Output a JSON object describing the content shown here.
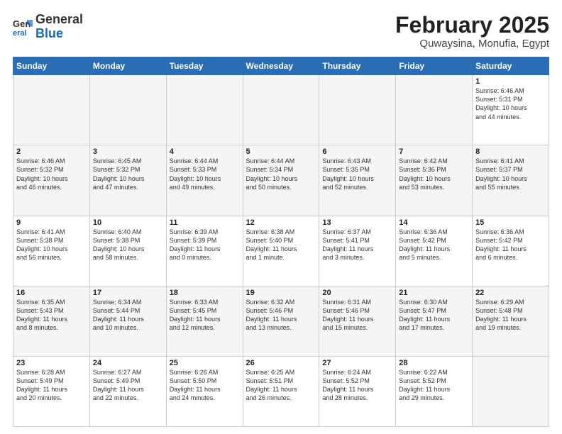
{
  "header": {
    "logo_general": "General",
    "logo_blue": "Blue",
    "month": "February 2025",
    "location": "Quwaysina, Monufia, Egypt"
  },
  "weekdays": [
    "Sunday",
    "Monday",
    "Tuesday",
    "Wednesday",
    "Thursday",
    "Friday",
    "Saturday"
  ],
  "weeks": [
    [
      {
        "day": "",
        "info": ""
      },
      {
        "day": "",
        "info": ""
      },
      {
        "day": "",
        "info": ""
      },
      {
        "day": "",
        "info": ""
      },
      {
        "day": "",
        "info": ""
      },
      {
        "day": "",
        "info": ""
      },
      {
        "day": "1",
        "info": "Sunrise: 6:46 AM\nSunset: 5:31 PM\nDaylight: 10 hours\nand 44 minutes."
      }
    ],
    [
      {
        "day": "2",
        "info": "Sunrise: 6:46 AM\nSunset: 5:32 PM\nDaylight: 10 hours\nand 46 minutes."
      },
      {
        "day": "3",
        "info": "Sunrise: 6:45 AM\nSunset: 5:32 PM\nDaylight: 10 hours\nand 47 minutes."
      },
      {
        "day": "4",
        "info": "Sunrise: 6:44 AM\nSunset: 5:33 PM\nDaylight: 10 hours\nand 49 minutes."
      },
      {
        "day": "5",
        "info": "Sunrise: 6:44 AM\nSunset: 5:34 PM\nDaylight: 10 hours\nand 50 minutes."
      },
      {
        "day": "6",
        "info": "Sunrise: 6:43 AM\nSunset: 5:35 PM\nDaylight: 10 hours\nand 52 minutes."
      },
      {
        "day": "7",
        "info": "Sunrise: 6:42 AM\nSunset: 5:36 PM\nDaylight: 10 hours\nand 53 minutes."
      },
      {
        "day": "8",
        "info": "Sunrise: 6:41 AM\nSunset: 5:37 PM\nDaylight: 10 hours\nand 55 minutes."
      }
    ],
    [
      {
        "day": "9",
        "info": "Sunrise: 6:41 AM\nSunset: 5:38 PM\nDaylight: 10 hours\nand 56 minutes."
      },
      {
        "day": "10",
        "info": "Sunrise: 6:40 AM\nSunset: 5:38 PM\nDaylight: 10 hours\nand 58 minutes."
      },
      {
        "day": "11",
        "info": "Sunrise: 6:39 AM\nSunset: 5:39 PM\nDaylight: 11 hours\nand 0 minutes."
      },
      {
        "day": "12",
        "info": "Sunrise: 6:38 AM\nSunset: 5:40 PM\nDaylight: 11 hours\nand 1 minute."
      },
      {
        "day": "13",
        "info": "Sunrise: 6:37 AM\nSunset: 5:41 PM\nDaylight: 11 hours\nand 3 minutes."
      },
      {
        "day": "14",
        "info": "Sunrise: 6:36 AM\nSunset: 5:42 PM\nDaylight: 11 hours\nand 5 minutes."
      },
      {
        "day": "15",
        "info": "Sunrise: 6:36 AM\nSunset: 5:42 PM\nDaylight: 11 hours\nand 6 minutes."
      }
    ],
    [
      {
        "day": "16",
        "info": "Sunrise: 6:35 AM\nSunset: 5:43 PM\nDaylight: 11 hours\nand 8 minutes."
      },
      {
        "day": "17",
        "info": "Sunrise: 6:34 AM\nSunset: 5:44 PM\nDaylight: 11 hours\nand 10 minutes."
      },
      {
        "day": "18",
        "info": "Sunrise: 6:33 AM\nSunset: 5:45 PM\nDaylight: 11 hours\nand 12 minutes."
      },
      {
        "day": "19",
        "info": "Sunrise: 6:32 AM\nSunset: 5:46 PM\nDaylight: 11 hours\nand 13 minutes."
      },
      {
        "day": "20",
        "info": "Sunrise: 6:31 AM\nSunset: 5:46 PM\nDaylight: 11 hours\nand 15 minutes."
      },
      {
        "day": "21",
        "info": "Sunrise: 6:30 AM\nSunset: 5:47 PM\nDaylight: 11 hours\nand 17 minutes."
      },
      {
        "day": "22",
        "info": "Sunrise: 6:29 AM\nSunset: 5:48 PM\nDaylight: 11 hours\nand 19 minutes."
      }
    ],
    [
      {
        "day": "23",
        "info": "Sunrise: 6:28 AM\nSunset: 5:49 PM\nDaylight: 11 hours\nand 20 minutes."
      },
      {
        "day": "24",
        "info": "Sunrise: 6:27 AM\nSunset: 5:49 PM\nDaylight: 11 hours\nand 22 minutes."
      },
      {
        "day": "25",
        "info": "Sunrise: 6:26 AM\nSunset: 5:50 PM\nDaylight: 11 hours\nand 24 minutes."
      },
      {
        "day": "26",
        "info": "Sunrise: 6:25 AM\nSunset: 5:51 PM\nDaylight: 11 hours\nand 26 minutes."
      },
      {
        "day": "27",
        "info": "Sunrise: 6:24 AM\nSunset: 5:52 PM\nDaylight: 11 hours\nand 28 minutes."
      },
      {
        "day": "28",
        "info": "Sunrise: 6:22 AM\nSunset: 5:52 PM\nDaylight: 11 hours\nand 29 minutes."
      },
      {
        "day": "",
        "info": ""
      }
    ]
  ]
}
